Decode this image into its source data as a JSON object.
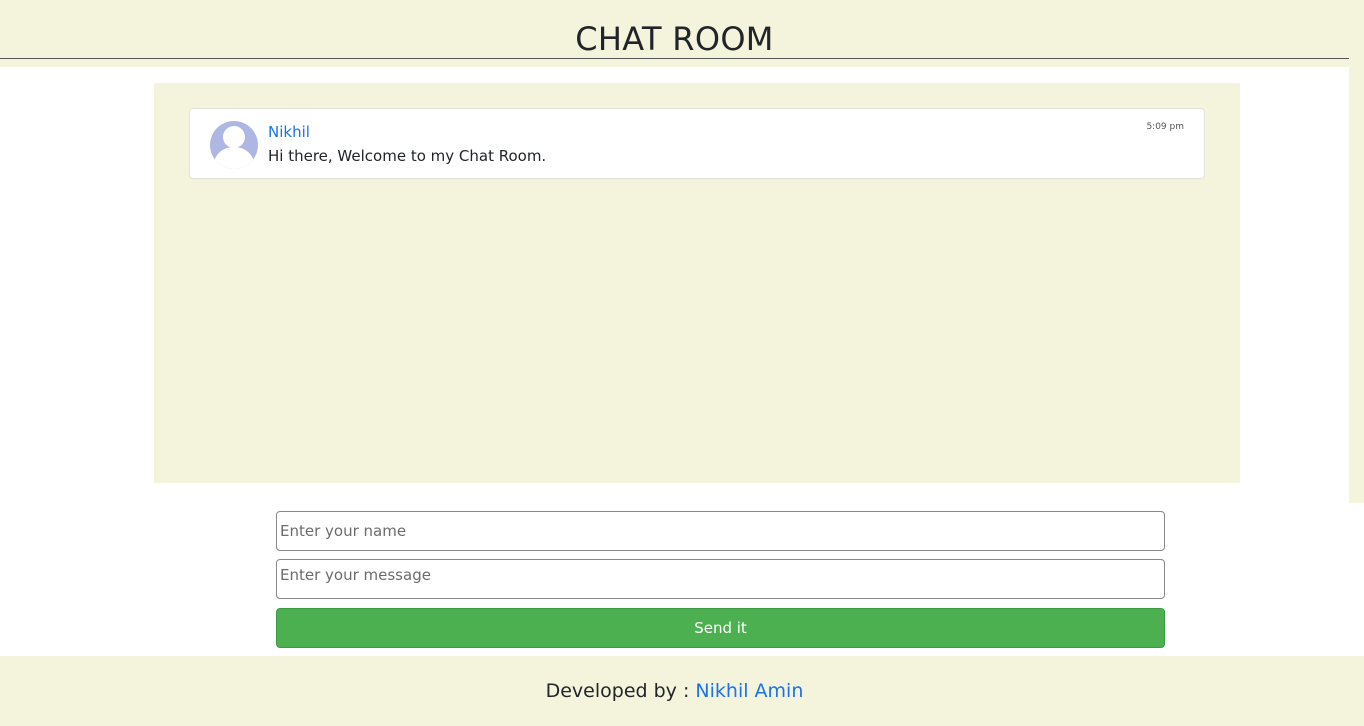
{
  "header": {
    "title": "CHAT ROOM"
  },
  "messages": [
    {
      "author": "Nikhil",
      "text": "Hi there, Welcome to my Chat Room.",
      "time": "5:09 pm",
      "avatar": "user-avatar-icon"
    }
  ],
  "form": {
    "name_placeholder": "Enter your name",
    "name_value": "",
    "message_placeholder": "Enter your message",
    "message_value": "",
    "send_label": "Send it"
  },
  "footer": {
    "prefix": "Developed by : ",
    "author": "Nikhil Amin"
  },
  "colors": {
    "panel_bg": "#f4f4dc",
    "link": "#1a73e8",
    "send_button": "#4caf50",
    "avatar": "#aeb6e4"
  }
}
